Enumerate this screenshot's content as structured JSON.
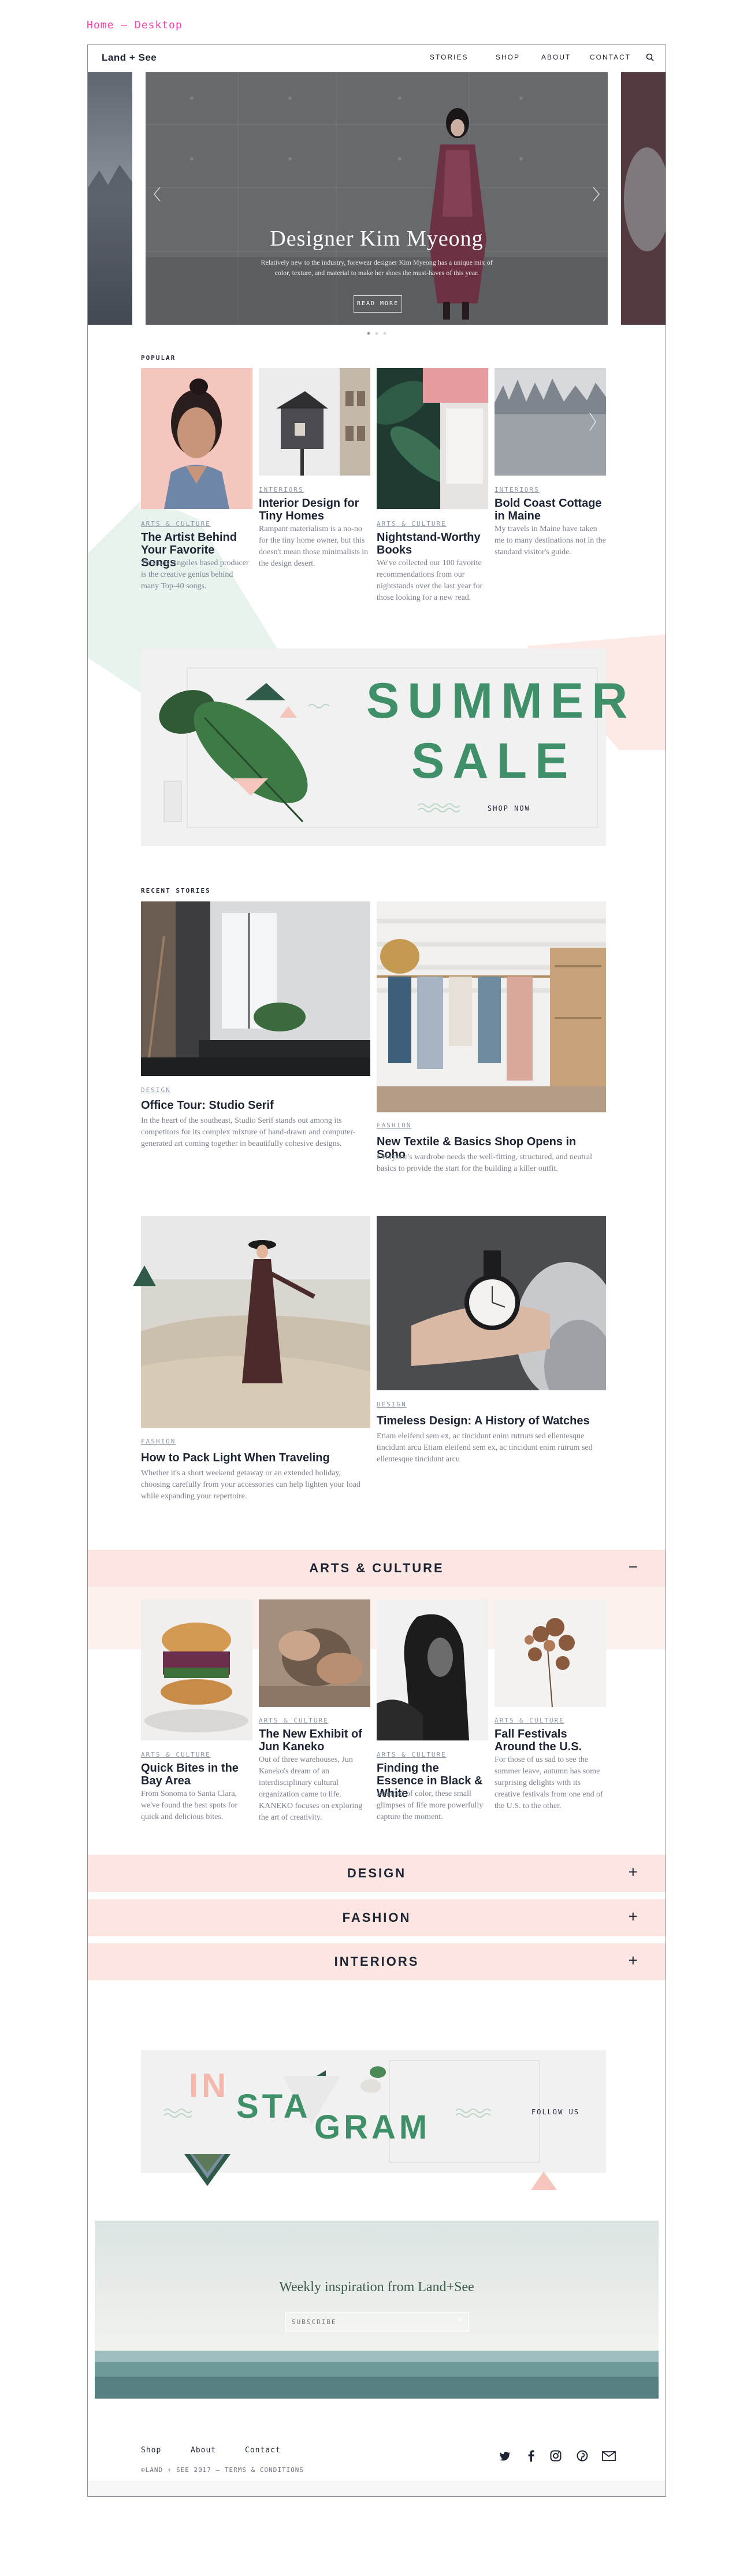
{
  "frame_label": "Home – Desktop",
  "header": {
    "logo": "Land + See",
    "nav": [
      "STORIES",
      "SHOP",
      "ABOUT",
      "CONTACT"
    ]
  },
  "hero": {
    "title": "Designer Kim Myeong",
    "subtitle": "Relatively new to the industry, forewear designer Kim Myeong has a unique mix of color, texture, and material to make her shoes the must-haves of this year.",
    "button": "READ MORE",
    "slides_total": 3,
    "slide_active": 1
  },
  "popular": {
    "label": "POPULAR",
    "cards": [
      {
        "tag": "ARTS & CULTURE",
        "title": "The Artist Behind Your Favorite Songs",
        "body": "This Los Angeles based producer is the creative genius behind many Top-40 songs."
      },
      {
        "tag": "INTERIORS",
        "title": "Interior Design for Tiny Homes",
        "body": "Rampant materialism is a no-no for the tiny home owner, but this doesn't mean those minimalists in the design desert."
      },
      {
        "tag": "ARTS & CULTURE",
        "title": "Nightstand-Worthy Books",
        "body": "We've collected our 100 favorite recommendations from our nightstands over the last year for those looking for a new read."
      },
      {
        "tag": "INTERIORS",
        "title": "Bold Coast Cottage in Maine",
        "body": "My travels in Maine have taken me to many destinations not in the standard visitor's guide."
      }
    ]
  },
  "promo": {
    "line1": "SUMMER",
    "line2": "SALE",
    "button": "SHOP NOW"
  },
  "recent": {
    "label": "RECENT STORIES",
    "cards": [
      {
        "tag": "DESIGN",
        "title": "Office Tour: Studio Serif",
        "body": "In the heart of the southeast, Studio Serif stands out among its competitors for its complex mixture of hand-drawn and computer-generated art coming together in beautifully cohesive designs."
      },
      {
        "tag": "FASHION",
        "title": "New Textile & Basics Shop Opens in Soho",
        "body": "Everyone's wardrobe needs the well-fitting, structured, and neutral basics to provide the start for the building a killer outfit."
      },
      {
        "tag": "FASHION",
        "title": "How to Pack Light When Traveling",
        "body": "Whether it's a short weekend getaway or an extended holiday, choosing carefully from your accessories can help lighten your load while expanding your repertoire."
      },
      {
        "tag": "DESIGN",
        "title": "Timeless Design: A History of Watches",
        "body": "Etiam eleifend sem ex, ac tincidunt enim rutrum sed ellentesque tincidunt arcu Etiam eleifend sem ex, ac tincidunt enim rutrum sed ellentesque tincidunt arcu"
      }
    ]
  },
  "arts_culture": {
    "title": "ARTS & CULTURE",
    "sign": "−",
    "cards": [
      {
        "tag": "ARTS & CULTURE",
        "title": "Quick Bites in the Bay Area",
        "body": "From Sonoma to Santa Clara, we've found the best spots for quick and delicious bites."
      },
      {
        "tag": "ARTS & CULTURE",
        "title": "The New Exhibit of Jun Kaneko",
        "body": "Out of three warehouses, Jun Kaneko's dream of an interdisciplinary cultural organization came to life. KANEKO focuses on exploring the art of creativity."
      },
      {
        "tag": "ARTS & CULTURE",
        "title": "Finding the Essence in Black & White",
        "body": "Stripped of color, these small glimpses of life more powerfully capture the moment."
      },
      {
        "tag": "ARTS & CULTURE",
        "title": "Fall Festivals Around the U.S.",
        "body": "For those of us sad to see the summer leave, autumn has some surprising delights with its creative festivals from one end of the U.S. to the other."
      }
    ]
  },
  "accordions": [
    {
      "title": "DESIGN",
      "sign": "+"
    },
    {
      "title": "FASHION",
      "sign": "+"
    },
    {
      "title": "INTERIORS",
      "sign": "+"
    }
  ],
  "instagram": {
    "letters_ins": "IN",
    "letters_sta": "STA",
    "letters_gram": "GRAM",
    "follow": "FOLLOW US"
  },
  "newsletter": {
    "heading_prefix": "Weekly inspiration from ",
    "heading_brand": "Land+See",
    "placeholder": "SUBSCRIBE",
    "submit_icon": "×"
  },
  "footer": {
    "links": [
      "Shop",
      "About",
      "Contact"
    ],
    "copyright": "©LAND + SEE 2017 — TERMS & CONDITIONS",
    "social_icons": [
      "twitter-icon",
      "facebook-icon",
      "instagram-icon",
      "pinterest-icon",
      "mail-icon"
    ]
  },
  "colors": {
    "accent_green": "#3f8f68",
    "accent_pink": "#f9c9c0",
    "accent_pink_light": "#fde6e2",
    "mint": "#e9f3ee",
    "frame_label": "#ff3fa7",
    "text": "#1d2433"
  }
}
